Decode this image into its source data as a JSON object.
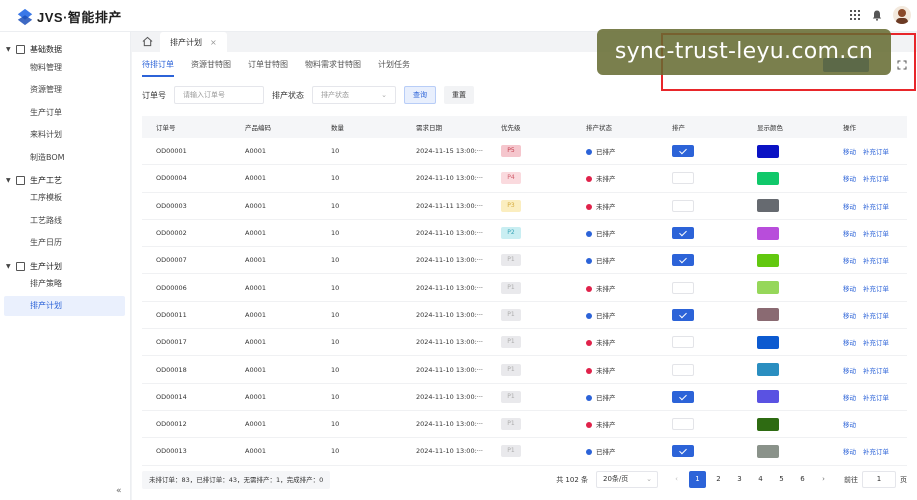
{
  "app": {
    "logo_text": "JVS·智能排产"
  },
  "sidebar": {
    "groups": [
      {
        "label": "基础数据",
        "items": [
          "物料管理",
          "资源管理",
          "生产订单",
          "来料计划",
          "制造BOM"
        ]
      },
      {
        "label": "生产工艺",
        "items": [
          "工序模板",
          "工艺路线",
          "生产日历"
        ]
      },
      {
        "label": "生产计划",
        "items": [
          "排产策略",
          "排产计划"
        ]
      }
    ],
    "active_item": "排产计划",
    "collapse_glyph": "«"
  },
  "page_tab": {
    "label": "排产计划",
    "close": "×"
  },
  "subtabs": [
    "待排订单",
    "资源甘特图",
    "订单甘特图",
    "物料需求甘特图",
    "计划任务"
  ],
  "active_subtab": "待排订单",
  "filter": {
    "order_label": "订单号",
    "order_placeholder": "请输入订单号",
    "status_label": "排产状态",
    "status_placeholder": "排产状态",
    "query_label": "查询",
    "reset_label": "重置"
  },
  "table": {
    "columns": [
      "订单号",
      "产品编码",
      "数量",
      "需求日期",
      "优先级",
      "排产状态",
      "排产",
      "显示颜色",
      "操作"
    ],
    "rows": [
      {
        "order": "OD00001",
        "product": "A0001",
        "qty": "10",
        "date": "2024-11-15 13:00:···",
        "priority": "P5",
        "status": "已排产",
        "scheduled": true,
        "color": "#0a12c4",
        "ops": [
          "移动",
          "补充订单"
        ]
      },
      {
        "order": "OD00004",
        "product": "A0001",
        "qty": "10",
        "date": "2024-11-10 13:00:···",
        "priority": "P4",
        "status": "未排产",
        "scheduled": false,
        "color": "#10c86a",
        "ops": [
          "移动",
          "补充订单"
        ]
      },
      {
        "order": "OD00003",
        "product": "A0001",
        "qty": "10",
        "date": "2024-11-11 13:00:···",
        "priority": "P3",
        "status": "未排产",
        "scheduled": false,
        "color": "#666a70",
        "ops": [
          "移动",
          "补充订单"
        ]
      },
      {
        "order": "OD00002",
        "product": "A0001",
        "qty": "10",
        "date": "2024-11-10 13:00:···",
        "priority": "P2",
        "status": "已排产",
        "scheduled": true,
        "color": "#b84ddb",
        "ops": [
          "移动",
          "补充订单"
        ]
      },
      {
        "order": "OD00007",
        "product": "A0001",
        "qty": "10",
        "date": "2024-11-10 13:00:···",
        "priority": "P1",
        "status": "已排产",
        "scheduled": true,
        "color": "#62c80f",
        "ops": [
          "移动",
          "补充订单"
        ]
      },
      {
        "order": "OD00006",
        "product": "A0001",
        "qty": "10",
        "date": "2024-11-10 13:00:···",
        "priority": "P1",
        "status": "未排产",
        "scheduled": false,
        "color": "#96d75a",
        "ops": [
          "移动",
          "补充订单"
        ]
      },
      {
        "order": "OD00011",
        "product": "A0001",
        "qty": "10",
        "date": "2024-11-10 13:00:···",
        "priority": "P1",
        "status": "已排产",
        "scheduled": true,
        "color": "#8a6a72",
        "ops": [
          "移动",
          "补充订单"
        ]
      },
      {
        "order": "OD00017",
        "product": "A0001",
        "qty": "10",
        "date": "2024-11-10 13:00:···",
        "priority": "P1",
        "status": "未排产",
        "scheduled": false,
        "color": "#0c5ad0",
        "ops": [
          "移动",
          "补充订单"
        ]
      },
      {
        "order": "OD00018",
        "product": "A0001",
        "qty": "10",
        "date": "2024-11-10 13:00:···",
        "priority": "P1",
        "status": "未排产",
        "scheduled": false,
        "color": "#2a8ec0",
        "ops": [
          "移动",
          "补充订单"
        ]
      },
      {
        "order": "OD00014",
        "product": "A0001",
        "qty": "10",
        "date": "2024-11-10 13:00:···",
        "priority": "P1",
        "status": "已排产",
        "scheduled": true,
        "color": "#5a52e2",
        "ops": [
          "移动",
          "补充订单"
        ]
      },
      {
        "order": "OD00012",
        "product": "A0001",
        "qty": "10",
        "date": "2024-11-10 13:00:···",
        "priority": "P1",
        "status": "未排产",
        "scheduled": false,
        "color": "#2e6b12",
        "ops": [
          "移动"
        ]
      },
      {
        "order": "OD00013",
        "product": "A0001",
        "qty": "10",
        "date": "2024-11-10 13:00:···",
        "priority": "P1",
        "status": "已排产",
        "scheduled": true,
        "color": "#8a928a",
        "ops": [
          "移动",
          "补充订单"
        ]
      }
    ]
  },
  "footer": {
    "summary": "未排订单：83，已排订单：43，无需排产：1，完成排产：0",
    "total": "共 102 条",
    "page_size": "20条/页",
    "pages": [
      "1",
      "2",
      "3",
      "4",
      "5",
      "6"
    ],
    "current_page": "1",
    "goto_label": "前往",
    "goto_value": "1",
    "page_suffix": "页"
  },
  "watermark": {
    "text": "sync-trust-leyu.com.cn"
  },
  "colors": {
    "accent": "#2c63d8",
    "scheduled_dot": "#2c63d8",
    "unscheduled_dot": "#e0224a",
    "priority": {
      "P5": "#f5c6cd",
      "P4": "#fadade",
      "P3": "#fbeec0",
      "P2": "#c9eef2",
      "P1": "#e9e9ec"
    },
    "priority_text": {
      "P5": "#c23a4a",
      "P4": "#d05c6a",
      "P3": "#d4aa3c",
      "P2": "#3aa6b8",
      "P1": "#aaaaaa"
    }
  }
}
